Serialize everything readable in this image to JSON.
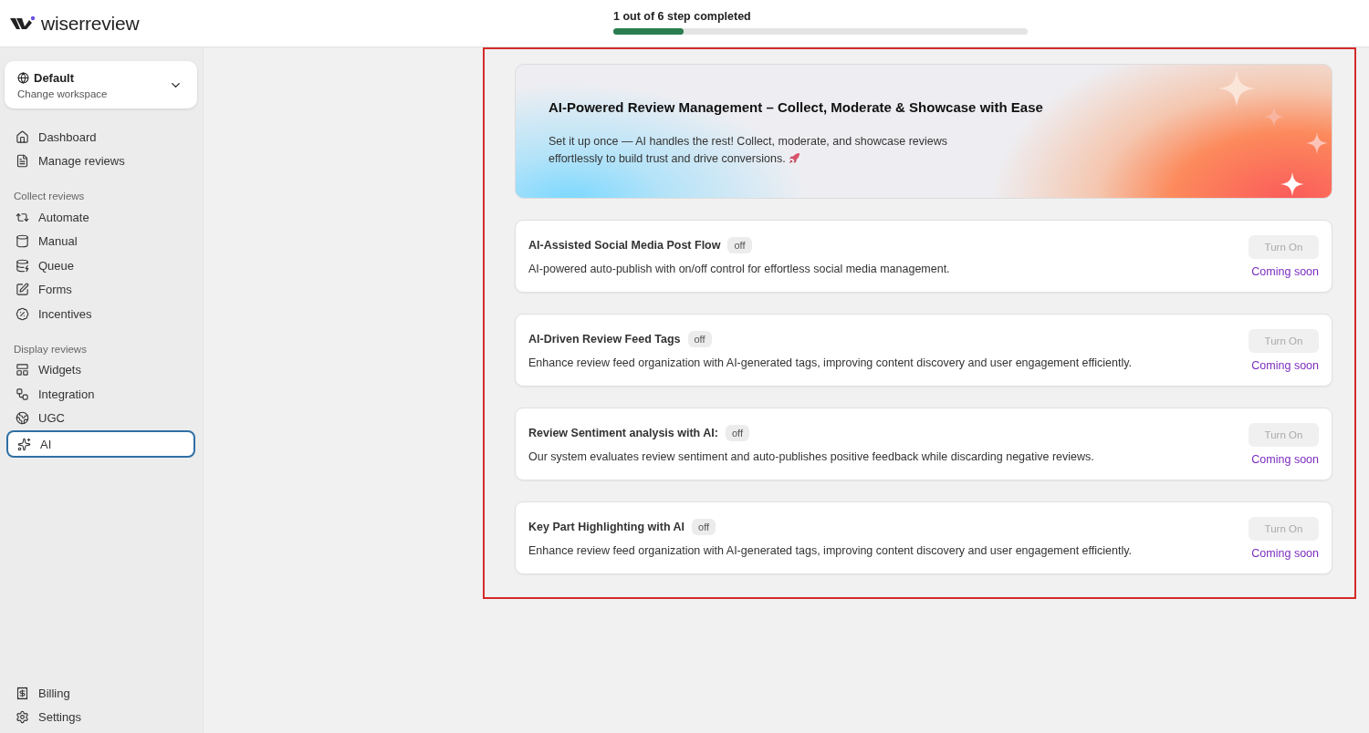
{
  "header": {
    "brand": "wiserreview",
    "progress": {
      "label": "1 out of 6 step completed",
      "level": 0.17
    }
  },
  "sidebar": {
    "workspace": {
      "name": "Default",
      "hint": "Change workspace"
    },
    "groups": [
      {
        "items": [
          {
            "label": "Dashboard",
            "selected": false
          },
          {
            "label": "Manage reviews",
            "selected": false
          }
        ]
      },
      {
        "title": "Collect reviews",
        "items": [
          {
            "label": "Automate",
            "selected": false
          },
          {
            "label": "Manual",
            "selected": false
          },
          {
            "label": "Queue",
            "selected": false
          },
          {
            "label": "Forms",
            "selected": false
          },
          {
            "label": "Incentives",
            "selected": false
          }
        ]
      },
      {
        "title": "Display reviews",
        "items": [
          {
            "label": "Widgets",
            "selected": false
          },
          {
            "label": "Integration",
            "selected": false
          },
          {
            "label": "UGC",
            "selected": false
          },
          {
            "label": "AI",
            "selected": true
          }
        ]
      }
    ],
    "bottom": [
      {
        "label": "Billing",
        "selected": false
      },
      {
        "label": "Settings",
        "selected": false
      }
    ]
  },
  "main": {
    "highlight": true,
    "banner": {
      "title": "AI-Powered Review Management – Collect, Moderate & Showcase with Ease",
      "text": "Set it up once — AI handles the rest! Collect, moderate, and showcase reviews effortlessly to build trust and drive conversions."
    },
    "features": [
      {
        "title": "AI-Assisted Social Media Post Flow",
        "status": "off",
        "description": "AI-powered auto-publish with on/off control for effortless social media management.",
        "button": "Turn On",
        "disabled": true,
        "note": "Coming soon"
      },
      {
        "title": "AI-Driven Review Feed Tags",
        "status": "off",
        "description": "Enhance review feed organization with AI-generated tags, improving content discovery and user engagement efficiently.",
        "button": "Turn On",
        "disabled": true,
        "note": "Coming soon"
      },
      {
        "title": "Review Sentiment analysis with AI:",
        "status": "off",
        "description": "Our system evaluates review sentiment and auto-publishes positive feedback while discarding negative reviews.",
        "button": "Turn On",
        "disabled": true,
        "note": "Coming soon"
      },
      {
        "title": "Key Part Highlighting with AI",
        "status": "off",
        "description": "Enhance review feed organization with AI-generated tags, improving content discovery and user engagement efficiently.",
        "button": "Turn On",
        "disabled": true,
        "note": "Coming soon"
      }
    ]
  }
}
